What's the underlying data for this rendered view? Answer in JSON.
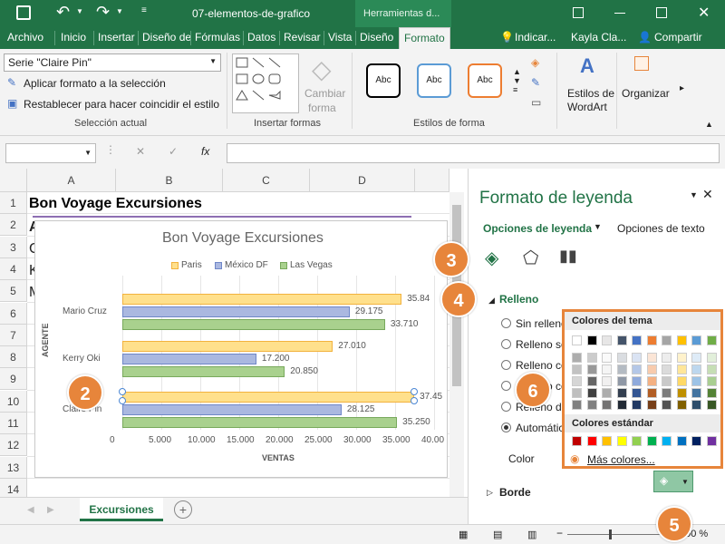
{
  "titlebar": {
    "filename": "07-elementos-de-grafico",
    "context": "Herramientas d...",
    "undo": "↶",
    "redo": "↷"
  },
  "tabs": [
    "Archivo",
    "Inicio",
    "Insertar",
    "Diseño de",
    "Fórmulas",
    "Datos",
    "Revisar",
    "Vista",
    "Diseño",
    "Formato"
  ],
  "tabs_right": {
    "tell": "Indicar...",
    "user": "Kayla Cla...",
    "share": "Compartir"
  },
  "ribbon": {
    "selection_value": "Serie \"Claire Pin\"",
    "apply_format": "Aplicar formato a la selección",
    "reset_style": "Restablecer para hacer coincidir el estilo",
    "group_selection": "Selección actual",
    "group_shapes": "Insertar formas",
    "change_shape_1": "Cambiar",
    "change_shape_2": "forma",
    "abc": "Abc",
    "group_shape_styles": "Estilos de forma",
    "wordart_1": "Estilos de",
    "wordart_2": "WordArt",
    "organize": "Organizar"
  },
  "formula": {
    "fx": "fx"
  },
  "grid": {
    "columns": [
      "A",
      "B",
      "C",
      "D"
    ],
    "rows": [
      "1",
      "2",
      "3",
      "4",
      "5",
      "6",
      "7",
      "8",
      "9",
      "10",
      "11",
      "12",
      "13",
      "14"
    ],
    "a1": "Bon Voyage Excursiones",
    "a_partial": [
      "A",
      "C",
      "K",
      "M"
    ]
  },
  "chart_data": {
    "type": "bar",
    "title": "Bon Voyage Excursiones",
    "xlabel": "VENTAS",
    "ylabel": "AGENTE",
    "categories": [
      "Mario Cruz",
      "Kerry Oki",
      "Claire Pin"
    ],
    "series": [
      {
        "name": "Paris",
        "values": [
          35840,
          27010,
          37450
        ],
        "color": "#ffe08c"
      },
      {
        "name": "México DF",
        "values": [
          29175,
          17200,
          28125
        ],
        "color": "#aab8e0"
      },
      {
        "name": "Las Vegas",
        "values": [
          33710,
          20850,
          35250
        ],
        "color": "#a9d18e"
      }
    ],
    "data_labels": {
      "Paris": [
        "35.84",
        "27.010",
        "37.45"
      ],
      "México DF": [
        "29.175",
        "17.200",
        "28.125"
      ],
      "Las Vegas": [
        "33.710",
        "20.850",
        "35.250"
      ]
    },
    "xticks": [
      "0",
      "5.000",
      "10.000",
      "15.000",
      "20.000",
      "25.000",
      "30.000",
      "35.000",
      "40.00"
    ],
    "xlim": [
      0,
      40000
    ],
    "legend_position": "top"
  },
  "pane": {
    "title": "Formato de leyenda",
    "tab_options": "Opciones de leyenda",
    "tab_text": "Opciones de texto",
    "fill_header": "Relleno",
    "fill_options": [
      "Sin relleno",
      "Relleno só",
      "Relleno co",
      "Relleno co",
      "Relleno de",
      "Automátic"
    ],
    "color_label": "Color",
    "border_header": "Borde"
  },
  "popup": {
    "theme_colors": "Colores del tema",
    "standard_colors": "Colores estándar",
    "more_colors": "Más colores...",
    "theme_top": [
      "#ffffff",
      "#000000",
      "#e7e6e6",
      "#44546a",
      "#4472c4",
      "#ed7d31",
      "#a5a5a5",
      "#ffc000",
      "#5b9bd5",
      "#70ad47"
    ],
    "standard": [
      "#c00000",
      "#ff0000",
      "#ffc000",
      "#ffff00",
      "#92d050",
      "#00b050",
      "#00b0f0",
      "#0070c0",
      "#002060",
      "#7030a0"
    ]
  },
  "sheet": {
    "tab": "Excursiones"
  },
  "status": {
    "zoom": "100 %"
  },
  "callouts": [
    "2",
    "3",
    "4",
    "5",
    "6"
  ]
}
